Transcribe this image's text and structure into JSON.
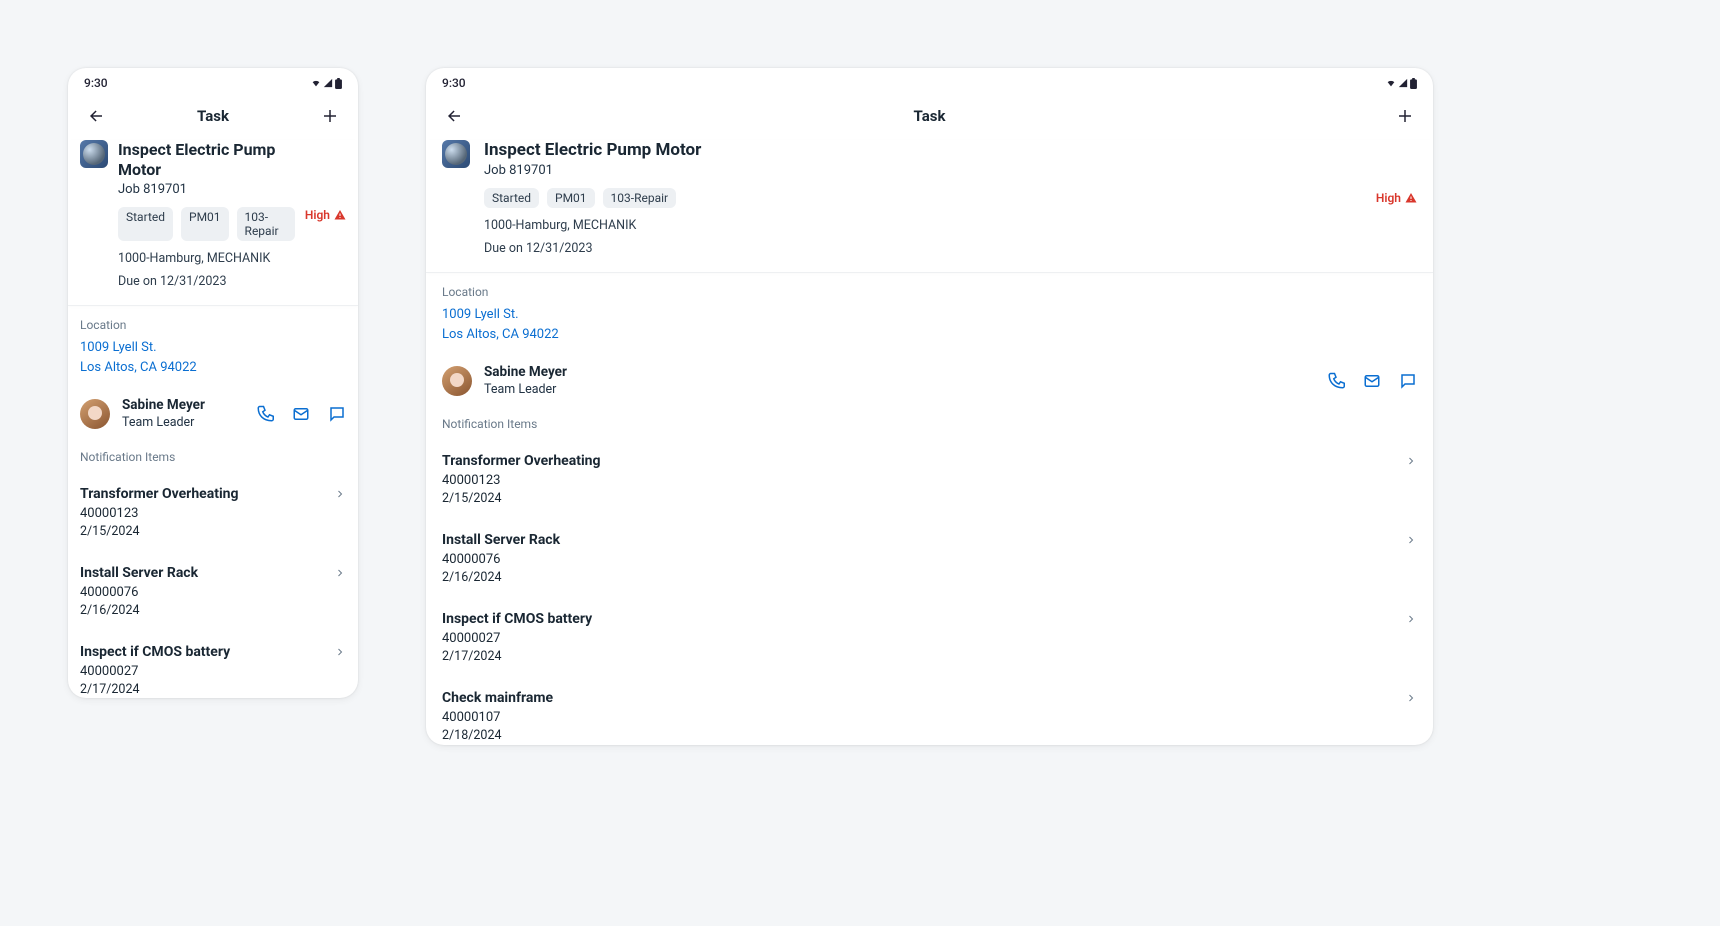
{
  "status_time": "9:30",
  "nav": {
    "title": "Task"
  },
  "task": {
    "title": "Inspect Electric Pump Motor",
    "job": "Job 819701",
    "tags": [
      "Started",
      "PM01",
      "103-Repair"
    ],
    "site": "1000-Hamburg, MECHANIK",
    "due": "Due on 12/31/2023",
    "priority": "High"
  },
  "location": {
    "label": "Location",
    "line1": "1009 Lyell St.",
    "line2": "Los Altos, CA 94022"
  },
  "contact": {
    "name": "Sabine Meyer",
    "role": "Team Leader"
  },
  "notifications": {
    "label": "Notification Items",
    "items": [
      {
        "title": "Transformer Overheating",
        "id": "40000123",
        "date": "2/15/2024"
      },
      {
        "title": "Install Server Rack",
        "id": "40000076",
        "date": "2/16/2024"
      },
      {
        "title": "Inspect if CMOS battery",
        "id": "40000027",
        "date": "2/17/2024"
      },
      {
        "title": "Check mainframe",
        "id": "40000107",
        "date": "2/18/2024"
      }
    ]
  }
}
